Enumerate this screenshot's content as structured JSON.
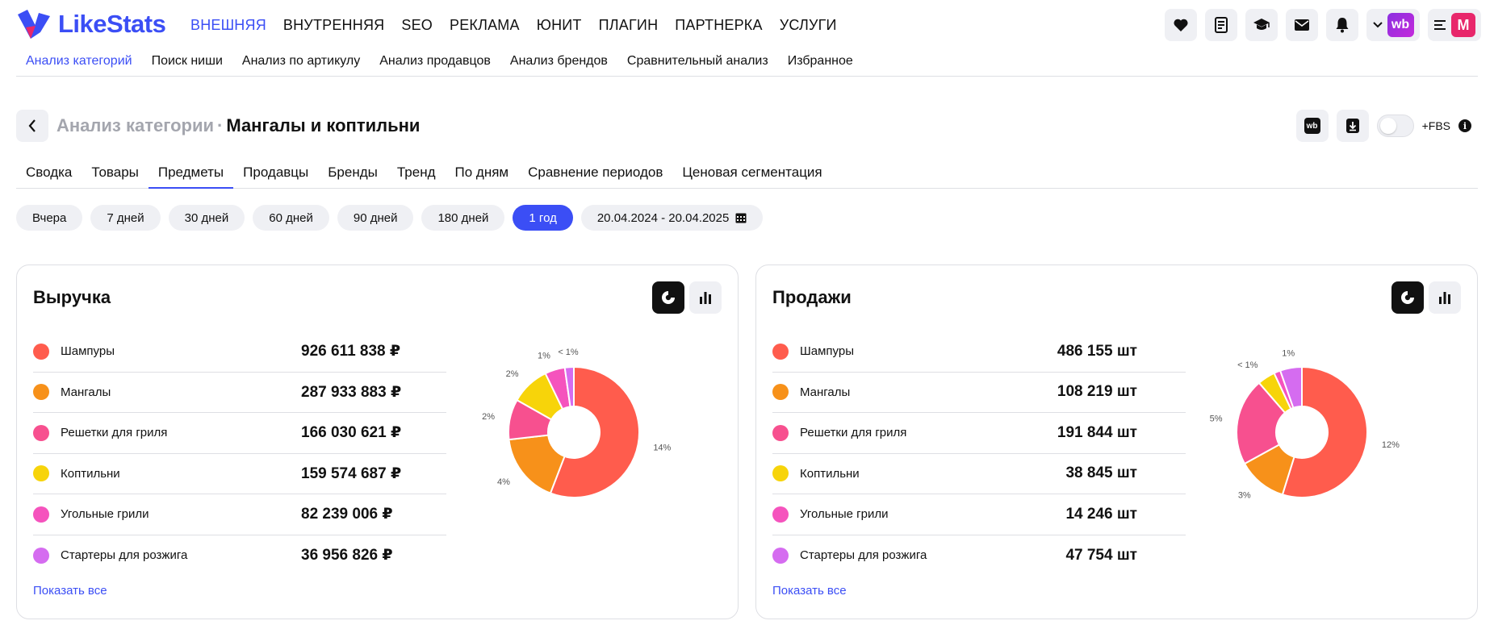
{
  "logo": {
    "text": "LikeStats"
  },
  "main_nav": [
    "ВНЕШНЯЯ",
    "ВНУТРЕННЯЯ",
    "SEO",
    "РЕКЛАМА",
    "ЮНИТ",
    "ПЛАГИН",
    "ПАРТНЕРКА",
    "УСЛУГИ"
  ],
  "main_nav_active": 0,
  "top_icons": {
    "wb": "wb",
    "m": "M",
    "icons": [
      "heart-icon",
      "document-icon",
      "graduation-cap-icon",
      "mail-icon",
      "bell-icon"
    ]
  },
  "sub_nav": [
    "Анализ категорий",
    "Поиск ниши",
    "Анализ по артикулу",
    "Анализ продавцов",
    "Анализ брендов",
    "Сравнительный анализ",
    "Избранное"
  ],
  "page": {
    "crumb": "Анализ категории",
    "separator": "·",
    "title": "Мангалы и коптильни",
    "wb_label": "wb",
    "fbs_label": "+FBS",
    "info": "i"
  },
  "tabs": [
    "Сводка",
    "Товары",
    "Предметы",
    "Продавцы",
    "Бренды",
    "Тренд",
    "По дням",
    "Сравнение периодов",
    "Ценовая сегментация"
  ],
  "tabs_active": 2,
  "periods": [
    "Вчера",
    "7 дней",
    "30 дней",
    "60 дней",
    "90 дней",
    "180 дней",
    "1 год"
  ],
  "periods_active": 6,
  "date_range": "20.04.2024 - 20.04.2025",
  "colors": {
    "accent": "#3b4ef5",
    "series": [
      "#ff5c4d",
      "#f7911a",
      "#f7508f",
      "#f7d40a",
      "#f553bd",
      "#d56cf0"
    ]
  },
  "cards": [
    {
      "title": "Выручка",
      "show_all": "Показать все",
      "rows": [
        {
          "label": "Шампуры",
          "value": "926 611 838 ₽"
        },
        {
          "label": "Мангалы",
          "value": "287 933 883 ₽"
        },
        {
          "label": "Решетки для гриля",
          "value": "166 030 621 ₽"
        },
        {
          "label": "Коптильни",
          "value": "159 574 687 ₽"
        },
        {
          "label": "Угольные грили",
          "value": "82 239 006 ₽"
        },
        {
          "label": "Стартеры для розжига",
          "value": "36 956 826 ₽"
        }
      ],
      "donut_labels": [
        "14%",
        "4%",
        "2%",
        "2%",
        "1%",
        "< 1%"
      ]
    },
    {
      "title": "Продажи",
      "show_all": "Показать все",
      "rows": [
        {
          "label": "Шампуры",
          "value": "486 155 шт"
        },
        {
          "label": "Мангалы",
          "value": "108 219 шт"
        },
        {
          "label": "Решетки для гриля",
          "value": "191 844 шт"
        },
        {
          "label": "Коптильни",
          "value": "38 845 шт"
        },
        {
          "label": "Угольные грили",
          "value": "14 246 шт"
        },
        {
          "label": "Стартеры для розжига",
          "value": "47 754 шт"
        }
      ],
      "donut_labels": [
        "12%",
        "3%",
        "5%",
        "< 1%",
        "1%"
      ]
    }
  ],
  "chart_data": [
    {
      "type": "pie",
      "title": "Выручка",
      "categories": [
        "Шампуры",
        "Мангалы",
        "Решетки для гриля",
        "Коптильни",
        "Угольные грили",
        "Стартеры для розжига"
      ],
      "values": [
        926611838,
        287933883,
        166030621,
        159574687,
        82239006,
        36956826
      ],
      "slice_labels": [
        "14%",
        "4%",
        "2%",
        "2%",
        "1%",
        "< 1%"
      ]
    },
    {
      "type": "pie",
      "title": "Продажи",
      "categories": [
        "Шампуры",
        "Мангалы",
        "Решетки для гриля",
        "Коптильни",
        "Угольные грили",
        "Стартеры для розжига"
      ],
      "values": [
        486155,
        108219,
        191844,
        38845,
        14246,
        47754
      ],
      "slice_labels": [
        "12%",
        "3%",
        "5%",
        "< 1%",
        "",
        "1%"
      ]
    }
  ]
}
